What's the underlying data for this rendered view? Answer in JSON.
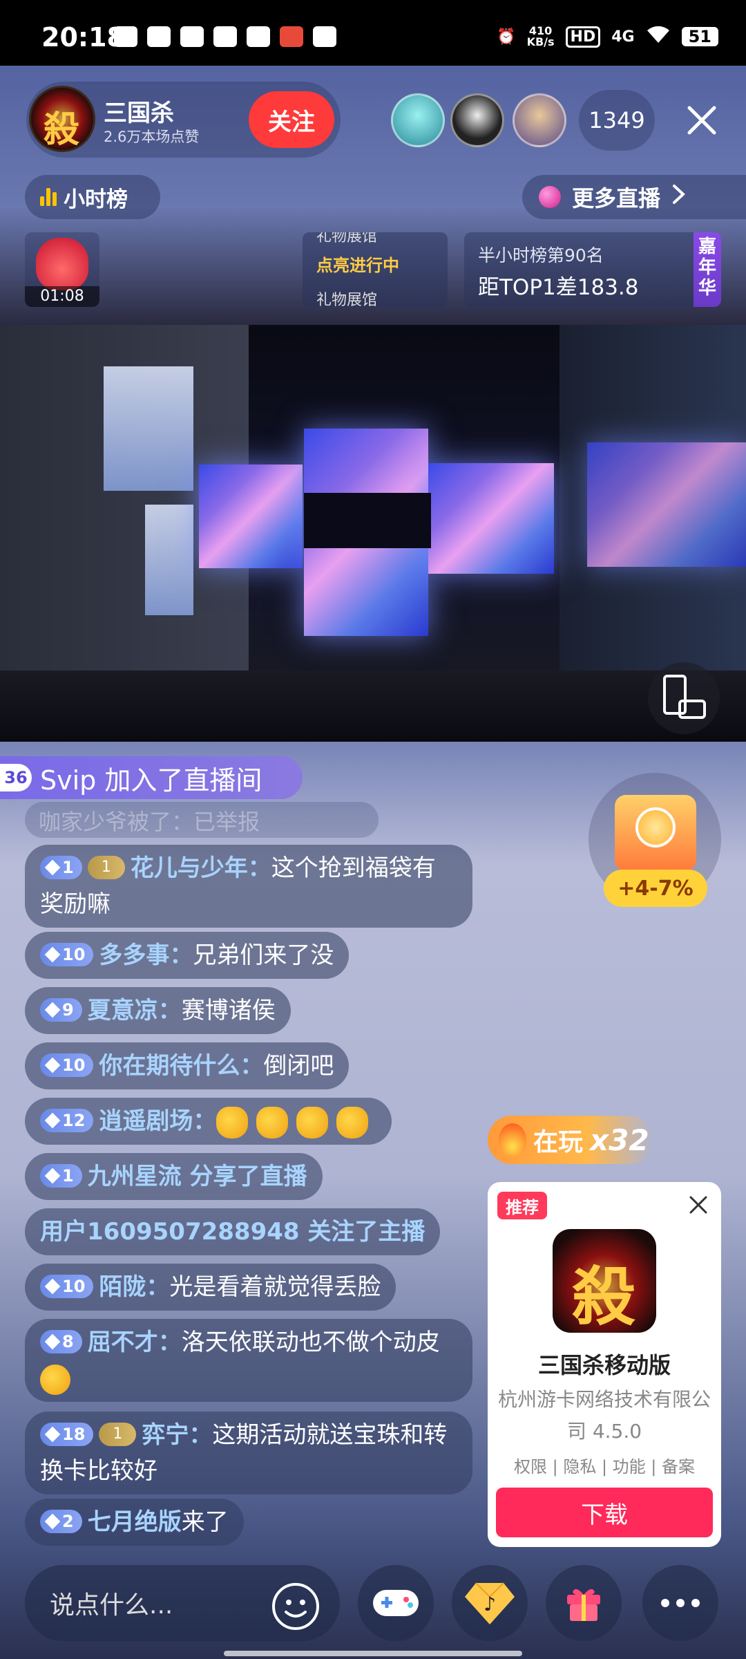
{
  "status_bar": {
    "time": "20:18",
    "speed_value": "410",
    "speed_unit": "KB/s",
    "hd": "HD",
    "network": "4G",
    "battery": "51"
  },
  "header": {
    "host_name": "三国杀",
    "host_logo_char": "殺",
    "host_likes": "2.6万本场点赞",
    "follow_label": "关注",
    "viewer_count": "1349"
  },
  "rank": {
    "hourly_label": "小时榜",
    "more_live_label": "更多直播",
    "gift_timer": "01:08",
    "ticker_top": "礼物展馆",
    "ticker_mid": "点亮进行中",
    "ticker_bottom": "礼物展馆",
    "rank_line1": "半小时榜第90名",
    "rank_line2": "距TOP1差183.8",
    "rank_tag": "嘉年华"
  },
  "chat": {
    "join_level": "36",
    "join_text": "Svip 加入了直播间",
    "ghost_text": "咖家少爷被了：已举报",
    "messages": [
      {
        "level": "1",
        "fan": "1",
        "name": "花儿与少年：",
        "text": "这个抢到福袋有奖励嘛"
      },
      {
        "level": "10",
        "name": "多多事：",
        "text": "兄弟们来了没"
      },
      {
        "level": "9",
        "name": "夏意凉：",
        "text": "赛博诸侯"
      },
      {
        "level": "10",
        "name": "你在期待什么：",
        "text": "倒闭吧"
      },
      {
        "level": "12",
        "name": "逍遥剧场：",
        "text": ""
      },
      {
        "level": "1",
        "name": "九州星流 分享了直播",
        "text": ""
      },
      {
        "name": "用户1609507288948 关注了主播",
        "text": ""
      },
      {
        "level": "10",
        "name": "陌陇：",
        "text": "光是看着就觉得丢脸"
      },
      {
        "level": "8",
        "name": "屈不才：",
        "text": "洛天依联动也不做个动皮"
      },
      {
        "level": "18",
        "fan": "1",
        "name": "弈宁：",
        "text": "这期活动就送宝珠和转换卡比较好"
      },
      {
        "level": "2",
        "name": "七月绝版",
        "text": "来了"
      }
    ]
  },
  "side": {
    "treasure_tag": "+4-7%",
    "playing_label": "在玩",
    "playing_count": "x32"
  },
  "recommend": {
    "tag": "推荐",
    "app_logo_char": "殺",
    "app_name": "三国杀移动版",
    "company": "杭州游卡网络技术有限公司 4.5.0",
    "links": "权限 | 隐私 | 功能 | 备案",
    "download_label": "下载"
  },
  "bottom": {
    "input_placeholder": "说点什么..."
  },
  "colors": {
    "follow": "#ff3a3a",
    "download": "#ff2a5a",
    "username": "#a8d4ff",
    "gold": "#ffc400"
  }
}
